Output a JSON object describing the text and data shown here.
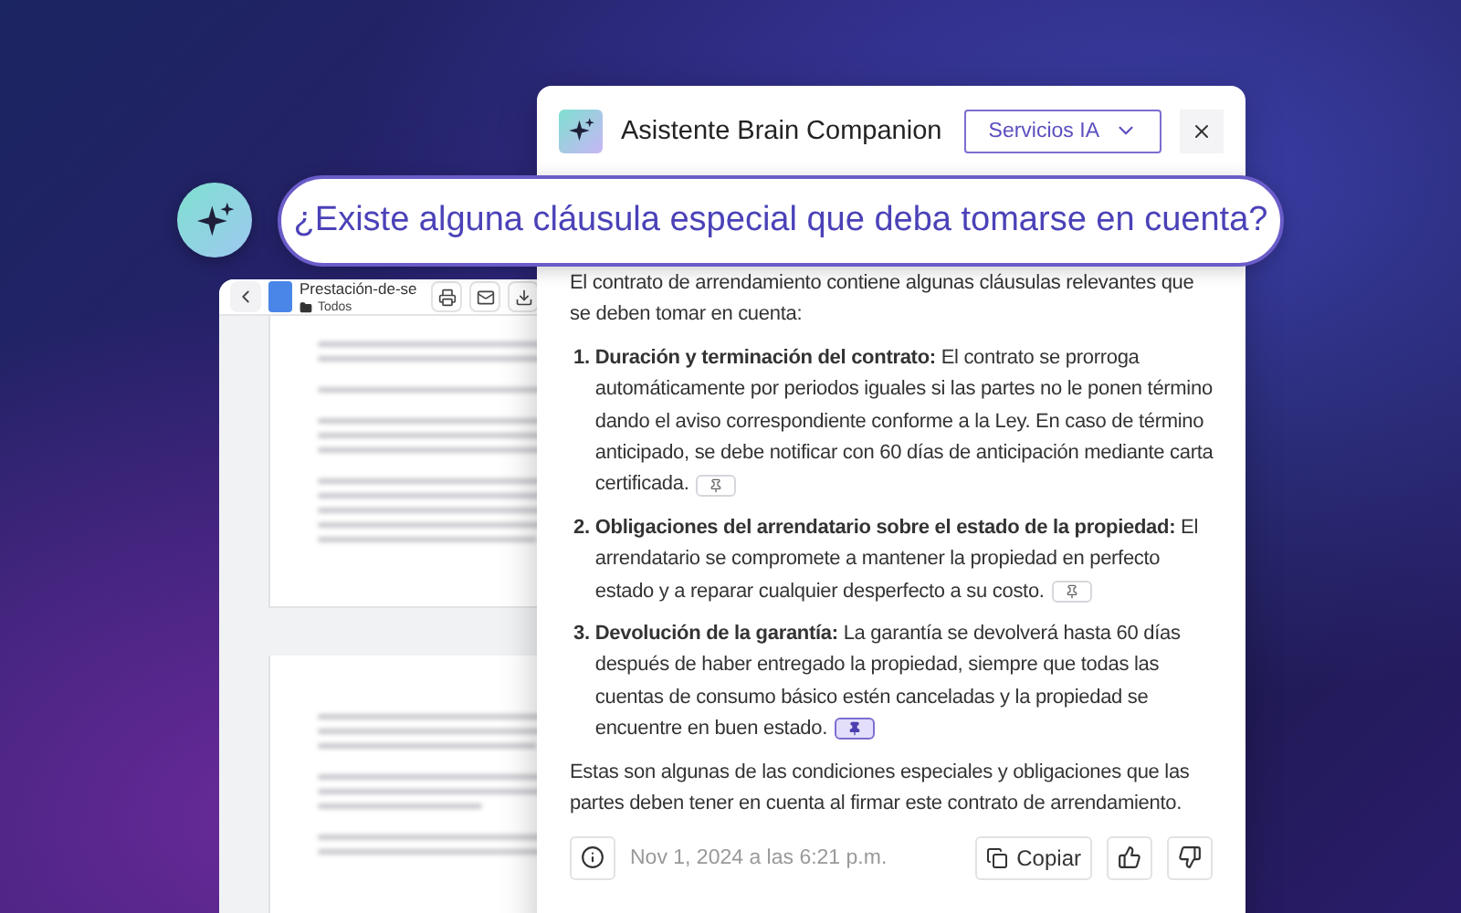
{
  "document": {
    "title": "Prestación-de-se",
    "folder": "Todos"
  },
  "assistant": {
    "title": "Asistente Brain Companion",
    "service_menu": {
      "label": "Servicios IA"
    }
  },
  "question": "¿Existe alguna cláusula especial que deba tomarse en cuenta?",
  "answer": {
    "intro": "El contrato de arrendamiento contiene algunas cláusulas relevantes que se deben tomar en cuenta:",
    "items": [
      {
        "number": "1.",
        "heading": "Duración y terminación del contrato:",
        "text": "El contrato se prorroga automáticamente por periodos iguales si las partes no le ponen término dando el aviso correspondiente conforme a la Ley. En caso de término anticipado, se debe notificar con 60 días de anticipación mediante carta certificada.",
        "pin_selected": false
      },
      {
        "number": "2.",
        "heading": "Obligaciones del arrendatario sobre el estado de la propiedad:",
        "text": "El arrendatario se compromete a mantener la propiedad en perfecto estado y a reparar cualquier desperfecto a su costo.",
        "pin_selected": false
      },
      {
        "number": "3.",
        "heading": "Devolución de la garantía:",
        "text": "La garantía se devolverá hasta 60 días después de haber entregado la propiedad, siempre que todas las cuentas de consumo básico estén canceladas y la propiedad se encuentre en buen estado.",
        "pin_selected": true
      }
    ],
    "closing": "Estas son algunas de las condiciones especiales y obligaciones que las partes deben tener en cuenta al firmar este contrato de arrendamiento."
  },
  "footer": {
    "timestamp": "Nov 1, 2024 a las 6:21 p.m.",
    "copy_label": "Copiar"
  }
}
